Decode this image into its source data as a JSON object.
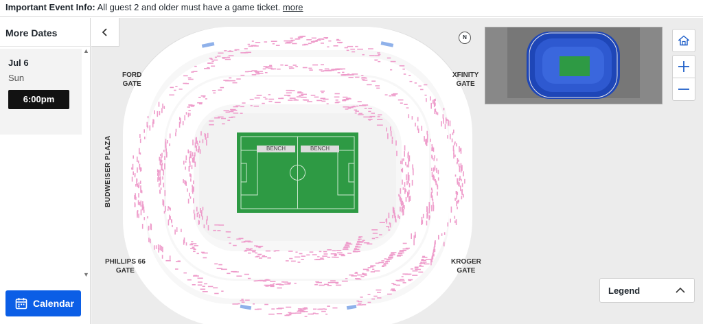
{
  "banner": {
    "label": "Important Event Info:",
    "text": "All guest 2 and older must have a game ticket.",
    "link": "more"
  },
  "sidebar": {
    "title": "More Dates",
    "date": "Jul 6",
    "weekday": "Sun",
    "time": "6:00pm",
    "calendar_label": "Calendar"
  },
  "map": {
    "gates": {
      "ford": [
        "FORD",
        "GATE"
      ],
      "xfinity": [
        "XFINITY",
        "GATE"
      ],
      "phillips": [
        "PHILLIPS 66",
        "GATE"
      ],
      "kroger": [
        "KROGER",
        "GATE"
      ]
    },
    "plaza": "BUDWEISER PLAZA",
    "bench_left": "BENCH",
    "bench_right": "BENCH",
    "compass": "N",
    "field_color": "#2e9a44",
    "available_seat_color": "#ee9ccb",
    "premium_color": "#8fb1ea",
    "section_color": "#ffffff"
  },
  "controls": {
    "legend_label": "Legend"
  },
  "icons": {
    "back": "chevron-left-icon",
    "home": "home-icon",
    "zoom_in": "plus-icon",
    "zoom_out": "minus-icon",
    "legend_toggle": "chevron-up-icon",
    "calendar": "calendar-icon"
  }
}
